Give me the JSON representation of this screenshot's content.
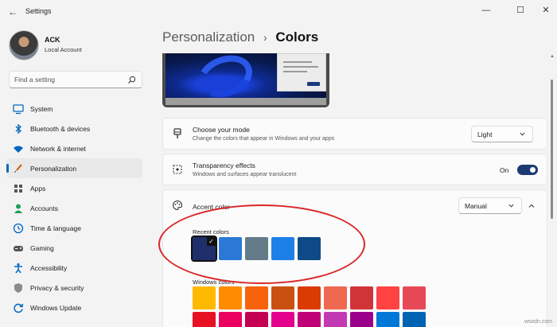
{
  "window": {
    "title": "Settings",
    "controls": {
      "minimize": "—",
      "maximize": "☐",
      "close": "✕"
    }
  },
  "profile": {
    "name": "ACK",
    "account_type": "Local Account"
  },
  "search": {
    "placeholder": "Find a setting"
  },
  "sidebar": {
    "items": [
      {
        "label": "System",
        "icon": "monitor-icon",
        "color": "#0067c0"
      },
      {
        "label": "Bluetooth & devices",
        "icon": "bluetooth-icon",
        "color": "#0067c0"
      },
      {
        "label": "Network & internet",
        "icon": "wifi-icon",
        "color": "#0067c0"
      },
      {
        "label": "Personalization",
        "icon": "brush-icon",
        "color": "#c45a10",
        "active": true
      },
      {
        "label": "Apps",
        "icon": "apps-icon",
        "color": "#555555"
      },
      {
        "label": "Accounts",
        "icon": "person-icon",
        "color": "#1f9e5a"
      },
      {
        "label": "Time & language",
        "icon": "globe-clock-icon",
        "color": "#0067c0"
      },
      {
        "label": "Gaming",
        "icon": "gamepad-icon",
        "color": "#555555"
      },
      {
        "label": "Accessibility",
        "icon": "accessibility-icon",
        "color": "#0067c0"
      },
      {
        "label": "Privacy & security",
        "icon": "shield-icon",
        "color": "#777777"
      },
      {
        "label": "Windows Update",
        "icon": "update-icon",
        "color": "#0067c0"
      }
    ]
  },
  "breadcrumb": {
    "parent": "Personalization",
    "separator": "›",
    "current": "Colors"
  },
  "mode_card": {
    "title": "Choose your mode",
    "description": "Change the colors that appear in Windows and your apps",
    "value": "Light"
  },
  "transparency_card": {
    "title": "Transparency effects",
    "description": "Windows and surfaces appear translucent",
    "state_label": "On",
    "enabled": true
  },
  "accent_card": {
    "title": "Accent color",
    "value": "Manual",
    "recent_label": "Recent colors",
    "recent_colors": [
      "#1e2f6b",
      "#2b79d6",
      "#637b89",
      "#1d7fe8",
      "#0d4a87"
    ],
    "selected_recent": 0,
    "windows_label": "Windows colors",
    "windows_colors_row1": [
      "#ffb900",
      "#ff8c00",
      "#f7630c",
      "#ca5010",
      "#da3b01",
      "#ef6950",
      "#d13438",
      "#ff4343",
      "#e74856"
    ],
    "windows_colors_row2": [
      "#e81123",
      "#ea005e",
      "#c30052",
      "#e3008c",
      "#bf0077",
      "#c239b3",
      "#9a0089",
      "#0078d7",
      "#0063b1"
    ]
  },
  "annotation": {
    "color": "#d92727"
  },
  "watermark": "wsxdn.com"
}
